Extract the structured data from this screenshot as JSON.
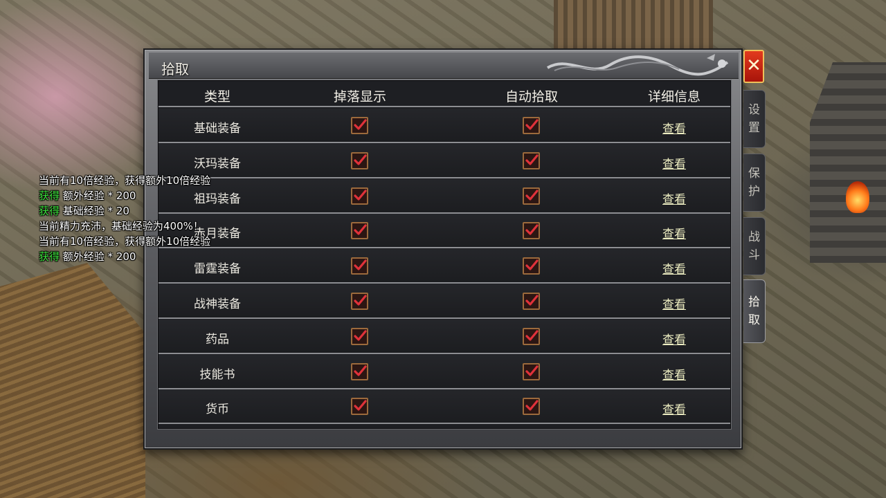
{
  "dialog": {
    "title": "拾取",
    "close_label": "✕"
  },
  "table": {
    "headers": [
      "类型",
      "掉落显示",
      "自动拾取",
      "详细信息"
    ],
    "rows": [
      {
        "label": "基础装备",
        "drop_display": true,
        "auto_pickup": true,
        "detail": "查看"
      },
      {
        "label": "沃玛装备",
        "drop_display": true,
        "auto_pickup": true,
        "detail": "查看"
      },
      {
        "label": "祖玛装备",
        "drop_display": true,
        "auto_pickup": true,
        "detail": "查看"
      },
      {
        "label": "赤月装备",
        "drop_display": true,
        "auto_pickup": true,
        "detail": "查看"
      },
      {
        "label": "雷霆装备",
        "drop_display": true,
        "auto_pickup": true,
        "detail": "查看"
      },
      {
        "label": "战神装备",
        "drop_display": true,
        "auto_pickup": true,
        "detail": "查看"
      },
      {
        "label": "药品",
        "drop_display": true,
        "auto_pickup": true,
        "detail": "查看"
      },
      {
        "label": "技能书",
        "drop_display": true,
        "auto_pickup": true,
        "detail": "查看"
      },
      {
        "label": "货币",
        "drop_display": true,
        "auto_pickup": true,
        "detail": "查看"
      }
    ]
  },
  "side_tabs": [
    {
      "c1": "设",
      "c2": "置",
      "active": false
    },
    {
      "c1": "保",
      "c2": "护",
      "active": false
    },
    {
      "c1": "战",
      "c2": "斗",
      "active": false
    },
    {
      "c1": "拾",
      "c2": "取",
      "active": true
    }
  ],
  "chat": {
    "lines": [
      {
        "prefix": "",
        "text": "当前有10倍经验，获得额外10倍经验"
      },
      {
        "prefix": "获得",
        "text": " 额外经验 * 200"
      },
      {
        "prefix": "获得",
        "text": " 基础经验 * 20"
      },
      {
        "prefix": "",
        "text": "当前精力充沛，基础经验为400%！"
      },
      {
        "prefix": "",
        "text": "当前有10倍经验，获得额外10倍经验"
      },
      {
        "prefix": "获得",
        "text": " 额外经验 * 200"
      }
    ]
  },
  "colors": {
    "checkmark": "#e0313a",
    "link": "#eeeec2",
    "gain_prefix": "#3de23d"
  }
}
